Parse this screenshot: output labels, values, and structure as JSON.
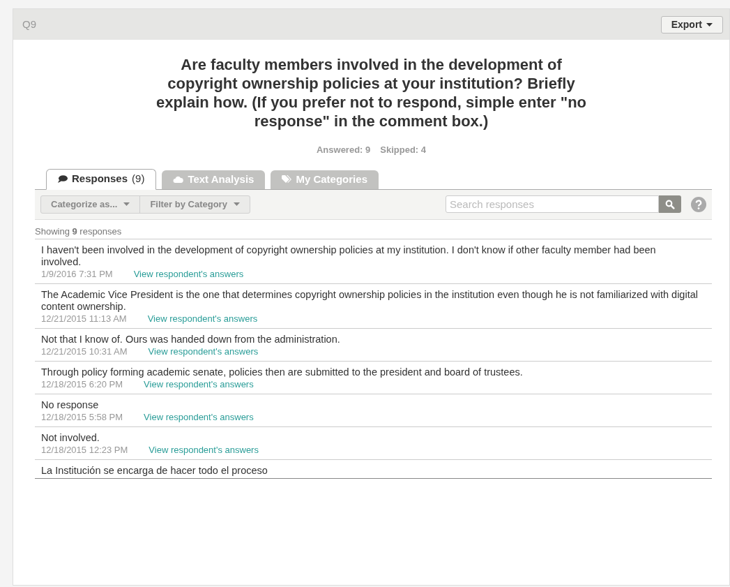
{
  "panel": {
    "question_number": "Q9",
    "export_button": "Export"
  },
  "question": "Are faculty members involved in the development of copyright ownership policies at your institution? Briefly explain how. (If you prefer not to respond, simple enter \"no response\" in the comment box.)",
  "stats": [
    "Answered: 9",
    "Skipped: 4"
  ],
  "tabs": [
    {
      "kind": "responses",
      "label": "Responses",
      "count": "(9)",
      "selected": true
    },
    {
      "kind": "analysis",
      "label": "Text Analysis",
      "selected": false
    },
    {
      "kind": "categories",
      "label": "My Categories",
      "selected": false
    }
  ],
  "toolbar": {
    "buttons": [
      "Categorize as...",
      "Filter by Category"
    ],
    "search": {
      "placeholder": "Search responses"
    }
  },
  "showing": "Showing **9** responses",
  "responses": [
    {
      "text": "I haven't been involved in the development of copyright ownership policies at my institution. I don't know if other faculty member had been involved.",
      "date": "1/9/2016 7:31 PM",
      "link": "View respondent's answers"
    },
    {
      "text": "The Academic Vice President is the one that determines copyright ownership policies in the institution even though he is not familiarized with digital content ownership.",
      "date": "12/21/2015 11:13 AM",
      "link": "View respondent's answers"
    },
    {
      "text": "Not that I know of. Ours was handed down from the administration.",
      "date": "12/21/2015 10:31 AM",
      "link": "View respondent's answers"
    },
    {
      "text": "Through policy forming academic senate, policies then are submitted to the president and board of trustees.",
      "date": "12/18/2015 6:20 PM",
      "link": "View respondent's answers"
    },
    {
      "text": "No response",
      "date": "12/18/2015 5:58 PM",
      "link": "View respondent's answers"
    },
    {
      "text": "Not involved.",
      "date": "12/18/2015 12:23 PM",
      "link": "View respondent's answers"
    },
    {
      "text": "La Institución se encarga de hacer todo el proceso"
    }
  ]
}
